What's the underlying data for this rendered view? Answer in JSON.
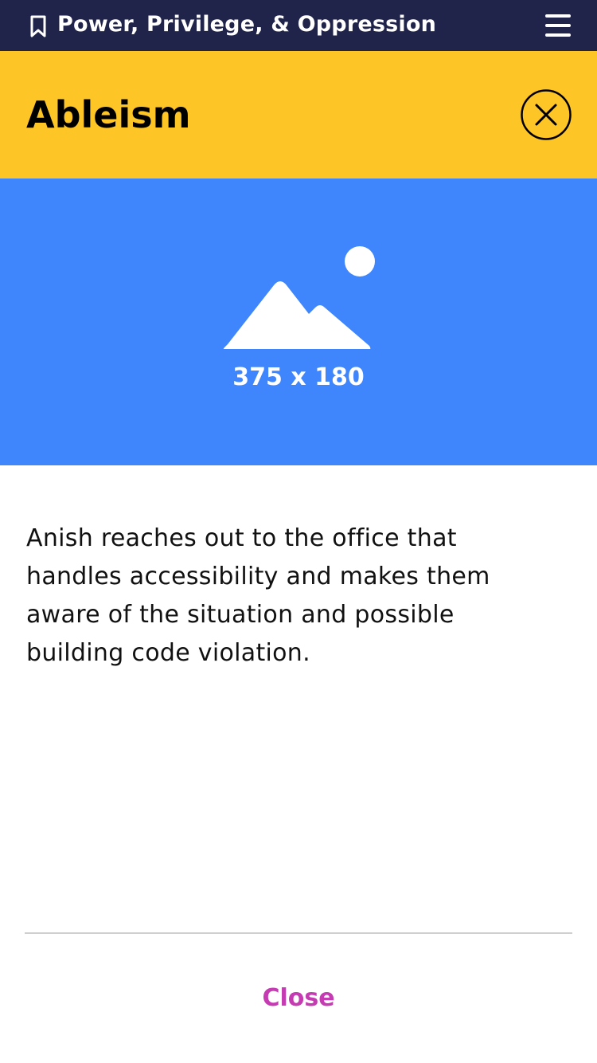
{
  "topbar": {
    "title": "Power, Privilege, & Oppression",
    "bookmark_icon": "bookmark-icon",
    "menu_icon": "hamburger-menu-icon",
    "background": "#20234a"
  },
  "header": {
    "title": "Ableism",
    "close_icon": "close-circle-icon",
    "background": "#fec527"
  },
  "image_placeholder": {
    "icon": "image-placeholder-icon",
    "caption": "375 x 180",
    "background": "#3f86fc"
  },
  "content": {
    "text": "Anish reaches out to the office that handles accessibility and makes them aware of the situation and possible building code violation."
  },
  "footer": {
    "close_label": "Close",
    "accent": "#c53bb1"
  }
}
